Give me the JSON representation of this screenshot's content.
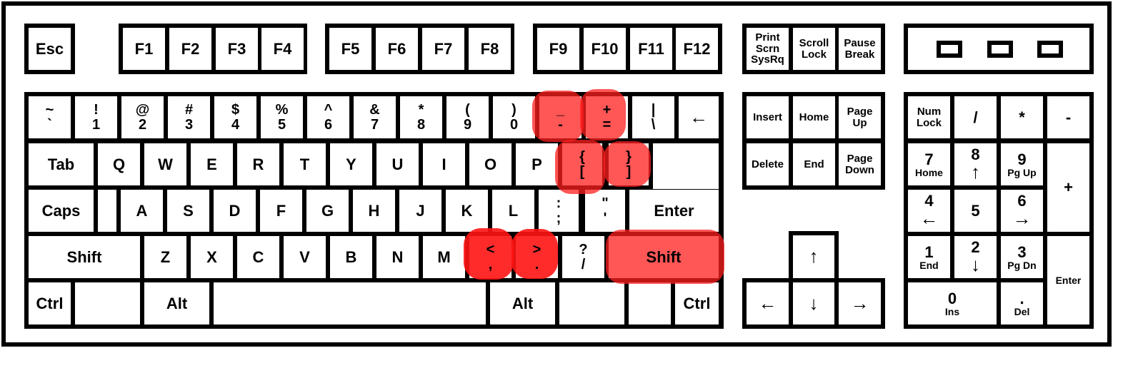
{
  "highlight_color": "#ff3b3b",
  "function_row": {
    "esc": "Esc",
    "f": [
      "F1",
      "F2",
      "F3",
      "F4",
      "F5",
      "F6",
      "F7",
      "F8",
      "F9",
      "F10",
      "F11",
      "F12"
    ],
    "sys": [
      {
        "lines": [
          "Print",
          "Scrn",
          "SysRq"
        ]
      },
      {
        "lines": [
          "Scroll",
          "Lock"
        ]
      },
      {
        "lines": [
          "Pause",
          "Break"
        ]
      }
    ],
    "indicator_lights": 3
  },
  "number_row": [
    {
      "top": "~",
      "bottom": "`"
    },
    {
      "top": "!",
      "bottom": "1"
    },
    {
      "top": "@",
      "bottom": "2"
    },
    {
      "top": "#",
      "bottom": "3"
    },
    {
      "top": "$",
      "bottom": "4"
    },
    {
      "top": "%",
      "bottom": "5"
    },
    {
      "top": "^",
      "bottom": "6"
    },
    {
      "top": "&",
      "bottom": "7"
    },
    {
      "top": "*",
      "bottom": "8"
    },
    {
      "top": "(",
      "bottom": "9"
    },
    {
      "top": ")",
      "bottom": "0"
    },
    {
      "top": "_",
      "bottom": "-",
      "highlighted": true
    },
    {
      "top": "+",
      "bottom": "=",
      "highlighted": true
    },
    {
      "top": "|",
      "bottom": "\\"
    },
    {
      "label": "←",
      "name": "backspace"
    }
  ],
  "qwerty_row": {
    "tab": "Tab",
    "letters": [
      "Q",
      "W",
      "E",
      "R",
      "T",
      "Y",
      "U",
      "I",
      "O",
      "P"
    ],
    "brackets": [
      {
        "top": "{",
        "bottom": "[",
        "highlighted": true
      },
      {
        "top": "}",
        "bottom": "]",
        "highlighted": true
      }
    ]
  },
  "home_row": {
    "caps": "Caps",
    "letters": [
      "A",
      "S",
      "D",
      "F",
      "G",
      "H",
      "J",
      "K",
      "L"
    ],
    "punct": [
      {
        "top": ":",
        "bottom": ";"
      },
      {
        "top": "\"",
        "bottom": "'"
      }
    ],
    "enter": "Enter"
  },
  "shift_row": {
    "left_shift": "Shift",
    "letters": [
      "Z",
      "X",
      "C",
      "V",
      "B",
      "N",
      "M"
    ],
    "punct": [
      {
        "top": "<",
        "bottom": ",",
        "highlighted": true
      },
      {
        "top": ">",
        "bottom": ".",
        "highlighted": true
      },
      {
        "top": "?",
        "bottom": "/"
      }
    ],
    "right_shift": "Shift",
    "right_shift_highlighted": true
  },
  "bottom_row": {
    "ctrl_left": "Ctrl",
    "alt_left": "Alt",
    "alt_right": "Alt",
    "ctrl_right": "Ctrl"
  },
  "nav_cluster": {
    "insert": "Insert",
    "home": "Home",
    "page_up": [
      "Page",
      "Up"
    ],
    "delete": "Delete",
    "end": "End",
    "page_down": [
      "Page",
      "Down"
    ]
  },
  "arrows": {
    "up": "↑",
    "left": "←",
    "down": "↓",
    "right": "→"
  },
  "numpad": {
    "numlock": [
      "Num",
      "Lock"
    ],
    "divide": "/",
    "multiply": "*",
    "minus": "-",
    "plus": "+",
    "k7": [
      "7",
      "Home"
    ],
    "k8": [
      "8",
      "↑"
    ],
    "k9": [
      "9",
      "Pg Up"
    ],
    "k4": [
      "4",
      "←"
    ],
    "k5": "5",
    "k6": [
      "6",
      "→"
    ],
    "k1": [
      "1",
      "End"
    ],
    "k2": [
      "2",
      "↓"
    ],
    "k3": [
      "3",
      "Pg Dn"
    ],
    "k0": [
      "0",
      "Ins"
    ],
    "dot": [
      ".",
      "Del"
    ],
    "enter": "Enter"
  }
}
